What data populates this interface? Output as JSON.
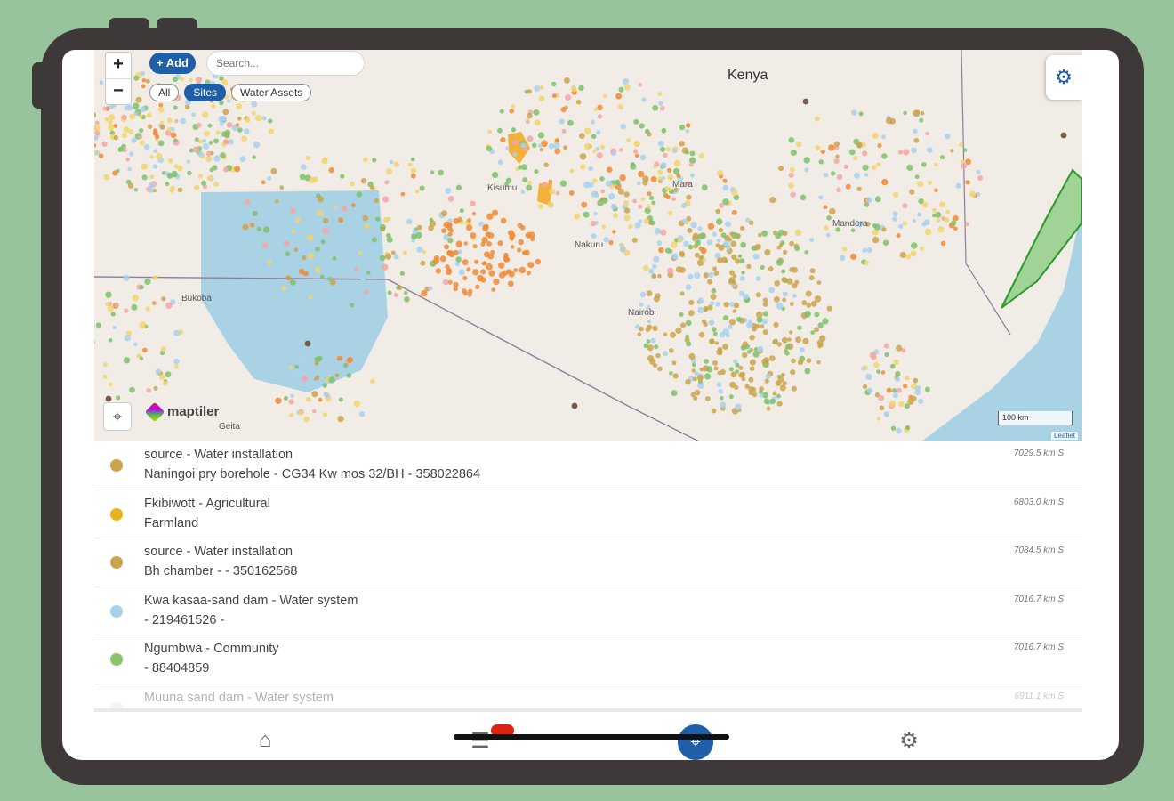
{
  "map": {
    "zoom_in": "+",
    "zoom_out": "−",
    "add_label": "+ Add",
    "search_placeholder": "Search...",
    "filters": [
      "All",
      "Sites",
      "Water Assets"
    ],
    "active_filter": "Sites",
    "labels": {
      "kenya": "Kenya",
      "bukoba": "Bukoba",
      "kisumu": "Kisumu",
      "mara": "Mara",
      "geita": "Geita",
      "nakuru": "Nakuru",
      "nairobi": "Nairobi",
      "mandera": "Mandera"
    },
    "brand": "maptiler",
    "scale": "100 km",
    "attribution": "Leaflet",
    "colors": {
      "water": "#a9d3e5",
      "land": "#f1ede6",
      "green": "#7ec16a",
      "blue": "#a8d1ef",
      "yellow": "#f2d46b",
      "orange": "#f08a36",
      "tan": "#cca34a",
      "brown": "#7a5a4a",
      "pink": "#f4a6a6"
    }
  },
  "list": [
    {
      "title": "source - Water installation",
      "subtitle": "Naningoi pry borehole - CG34 Kw mos 32/BH - 358022864",
      "distance": "7029.5 km S",
      "color": "#cca34a"
    },
    {
      "title": "Fkibiwott - Agricultural",
      "subtitle": "Farmland",
      "distance": "6803.0 km S",
      "color": "#eab21a"
    },
    {
      "title": "source - Water installation",
      "subtitle": "Bh chamber - - 350162568",
      "distance": "7084.5 km S",
      "color": "#cca34a"
    },
    {
      "title": "Kwa kasaa-sand dam - Water system",
      "subtitle": "- 219461526 -",
      "distance": "7016.7 km S",
      "color": "#a8d1ef"
    },
    {
      "title": "Ngumbwa - Community",
      "subtitle": "- 88404859",
      "distance": "7016.7 km S",
      "color": "#88c46a"
    },
    {
      "title": "Muuna sand dam - Water system",
      "subtitle": "",
      "distance": "6911.1 km S",
      "color": "#dfe6ee"
    }
  ],
  "tabs": [
    {
      "name": "home-icon",
      "glyph": "⌂"
    },
    {
      "name": "list-icon",
      "glyph": "☰"
    },
    {
      "name": "map-pin-icon",
      "glyph": "⌖"
    },
    {
      "name": "gear-icon",
      "glyph": "⚙"
    }
  ],
  "settings_glyph": "⚙",
  "locate_glyph": "⌖"
}
